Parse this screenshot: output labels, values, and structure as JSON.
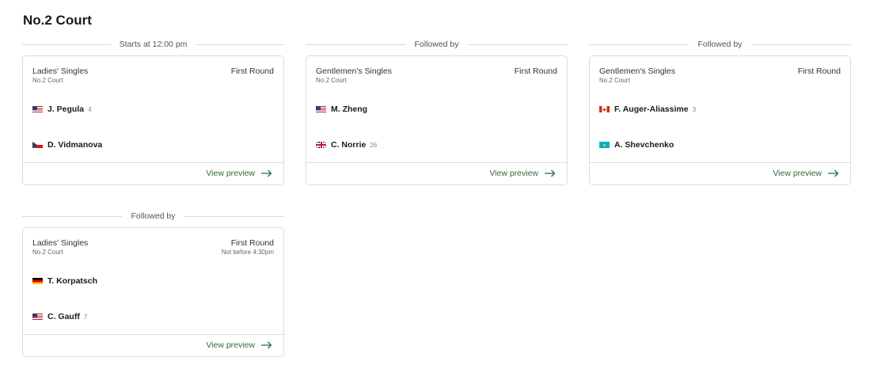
{
  "court": {
    "title": "No.2 Court"
  },
  "colors": {
    "accent": "#2e6b3a",
    "border": "#dcdcdc"
  },
  "matches": [
    {
      "divider": "Starts at 12:00 pm",
      "event": "Ladies' Singles",
      "court": "No.2 Court",
      "round": "First Round",
      "note": "",
      "players": [
        {
          "flag": "us-flag-icon",
          "name": "J. Pegula",
          "seed": "4"
        },
        {
          "flag": "cz-flag-icon",
          "name": "D. Vidmanova",
          "seed": ""
        }
      ],
      "preview": "View preview"
    },
    {
      "divider": "Followed by",
      "event": "Gentlemen's Singles",
      "court": "No.2 Court",
      "round": "First Round",
      "note": "",
      "players": [
        {
          "flag": "us-flag-icon",
          "name": "M. Zheng",
          "seed": ""
        },
        {
          "flag": "gb-flag-icon",
          "name": "C. Norrie",
          "seed": "26"
        }
      ],
      "preview": "View preview"
    },
    {
      "divider": "Followed by",
      "event": "Gentlemen's Singles",
      "court": "No.2 Court",
      "round": "First Round",
      "note": "",
      "players": [
        {
          "flag": "ca-flag-icon",
          "name": "F. Auger-Aliassime",
          "seed": "3"
        },
        {
          "flag": "kz-flag-icon",
          "name": "A. Shevchenko",
          "seed": ""
        }
      ],
      "preview": "View preview"
    },
    {
      "divider": "Followed by",
      "event": "Ladies' Singles",
      "court": "No.2 Court",
      "round": "First Round",
      "note": "Not before 4:30pm",
      "players": [
        {
          "flag": "de-flag-icon",
          "name": "T. Korpatsch",
          "seed": ""
        },
        {
          "flag": "us-flag-icon",
          "name": "C. Gauff",
          "seed": "7"
        }
      ],
      "preview": "View preview"
    }
  ]
}
